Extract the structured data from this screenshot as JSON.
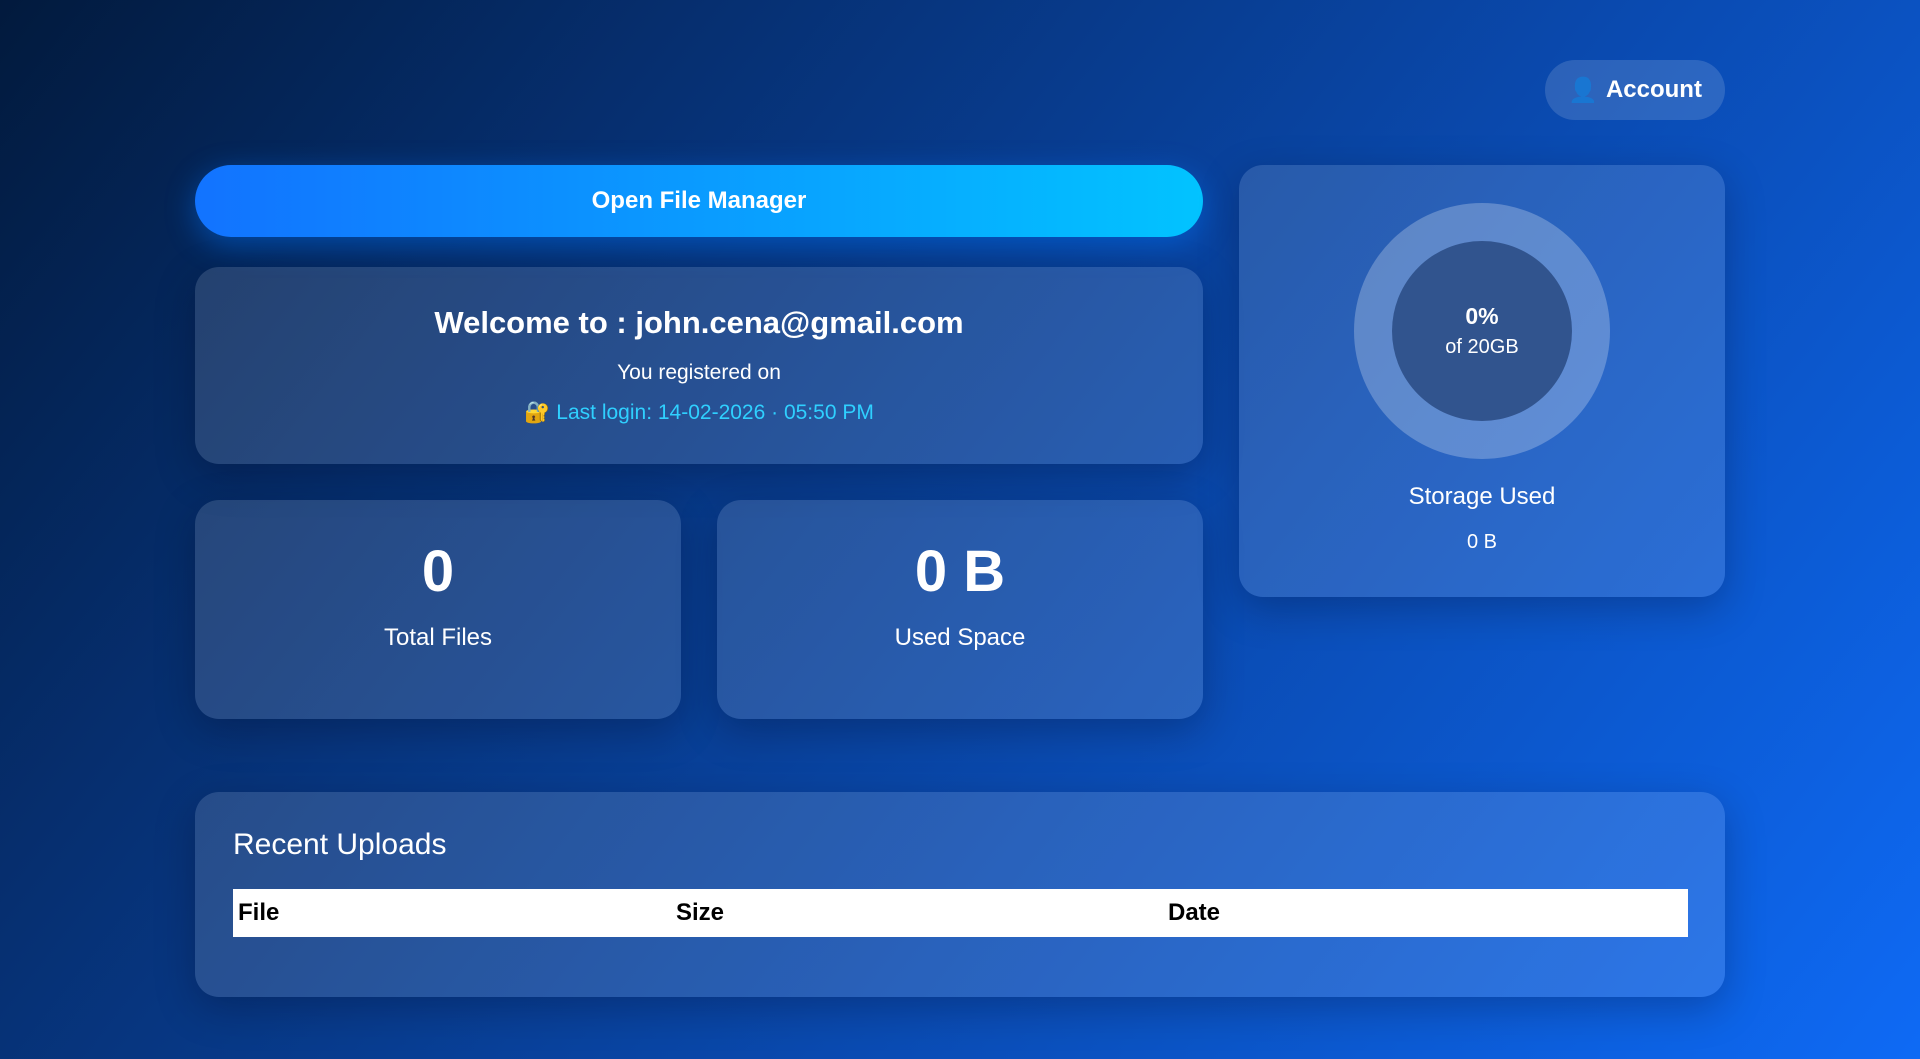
{
  "header": {
    "account_label": "Account",
    "account_icon": "user-icon"
  },
  "actions": {
    "open_file_manager": "Open File Manager"
  },
  "welcome": {
    "title": "Welcome to : john.cena@gmail.com",
    "registered": "You registered on",
    "last_login_icon": "🔐",
    "last_login": "Last login: 14-02-2026 · 05:50 PM"
  },
  "stats": {
    "total_files_value": "0",
    "total_files_label": "Total Files",
    "used_space_value": "0 B",
    "used_space_label": "Used Space"
  },
  "storage": {
    "percent": "0%",
    "of_total": "of 20GB",
    "label": "Storage Used",
    "value": "0 B"
  },
  "recent": {
    "title": "Recent Uploads",
    "columns": [
      "File",
      "Size",
      "Date"
    ],
    "rows": []
  },
  "colors": {
    "accent_start": "#1273ff",
    "accent_end": "#02c3ff",
    "login_text": "#2fd0ff"
  }
}
